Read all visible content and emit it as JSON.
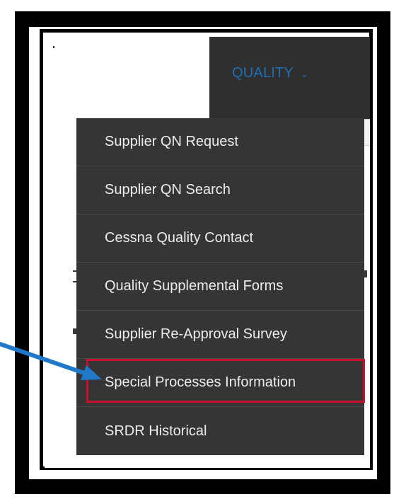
{
  "nav": {
    "menu_title": "QUALITY",
    "chevron_icon": "chevron-down-icon"
  },
  "dropdown": {
    "items": [
      {
        "label": "Supplier QN Request"
      },
      {
        "label": "Supplier QN Search"
      },
      {
        "label": "Cessna Quality Contact"
      },
      {
        "label": "Quality Supplemental Forms"
      },
      {
        "label": "Supplier Re-Approval Survey"
      },
      {
        "label": "Special Processes Information",
        "highlighted": true
      },
      {
        "label": "SRDR Historical"
      }
    ]
  },
  "annotation": {
    "arrow_icon": "arrow-icon",
    "arrow_color": "#1f78c8",
    "highlight_color": "#c8102e"
  },
  "colors": {
    "menu_background": "#353535",
    "menu_text": "#ededed",
    "nav_accent": "#1d6fb5"
  }
}
